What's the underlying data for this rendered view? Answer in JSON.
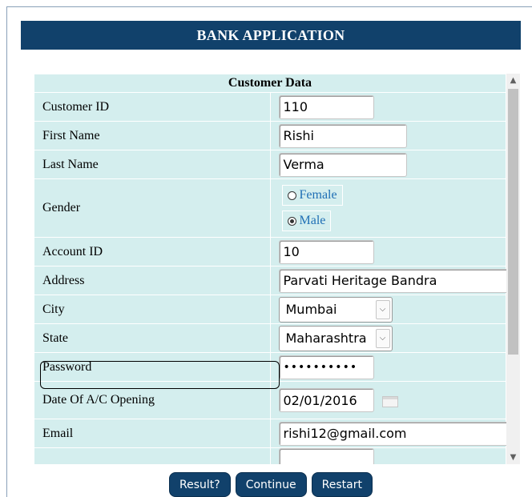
{
  "title": "BANK APPLICATION",
  "section_title": "Customer Data",
  "fields": {
    "customer_id": {
      "label": "Customer ID",
      "value": "110"
    },
    "first_name": {
      "label": "First Name",
      "value": "Rishi"
    },
    "last_name": {
      "label": "Last Name",
      "value": "Verma"
    },
    "gender": {
      "label": "Gender",
      "options": [
        "Female",
        "Male"
      ],
      "selected": "Male"
    },
    "account_id": {
      "label": "Account ID",
      "value": "10"
    },
    "address": {
      "label": "Address",
      "value": "Parvati Heritage Bandra"
    },
    "city": {
      "label": "City",
      "value": "Mumbai"
    },
    "state": {
      "label": "State",
      "value": "Maharashtra"
    },
    "password": {
      "label": "Password",
      "value": "••••••••••"
    },
    "date_opening": {
      "label": "Date Of A/C Opening",
      "value": "02/01/2016"
    },
    "email": {
      "label": "Email",
      "value": "rishi12@gmail.com"
    }
  },
  "buttons": {
    "result": "Result?",
    "continue": "Continue",
    "restart": "Restart"
  },
  "colors": {
    "header_bg": "#11416b",
    "row_bg": "#d4eeee",
    "radio_text": "#1f6fb5"
  }
}
